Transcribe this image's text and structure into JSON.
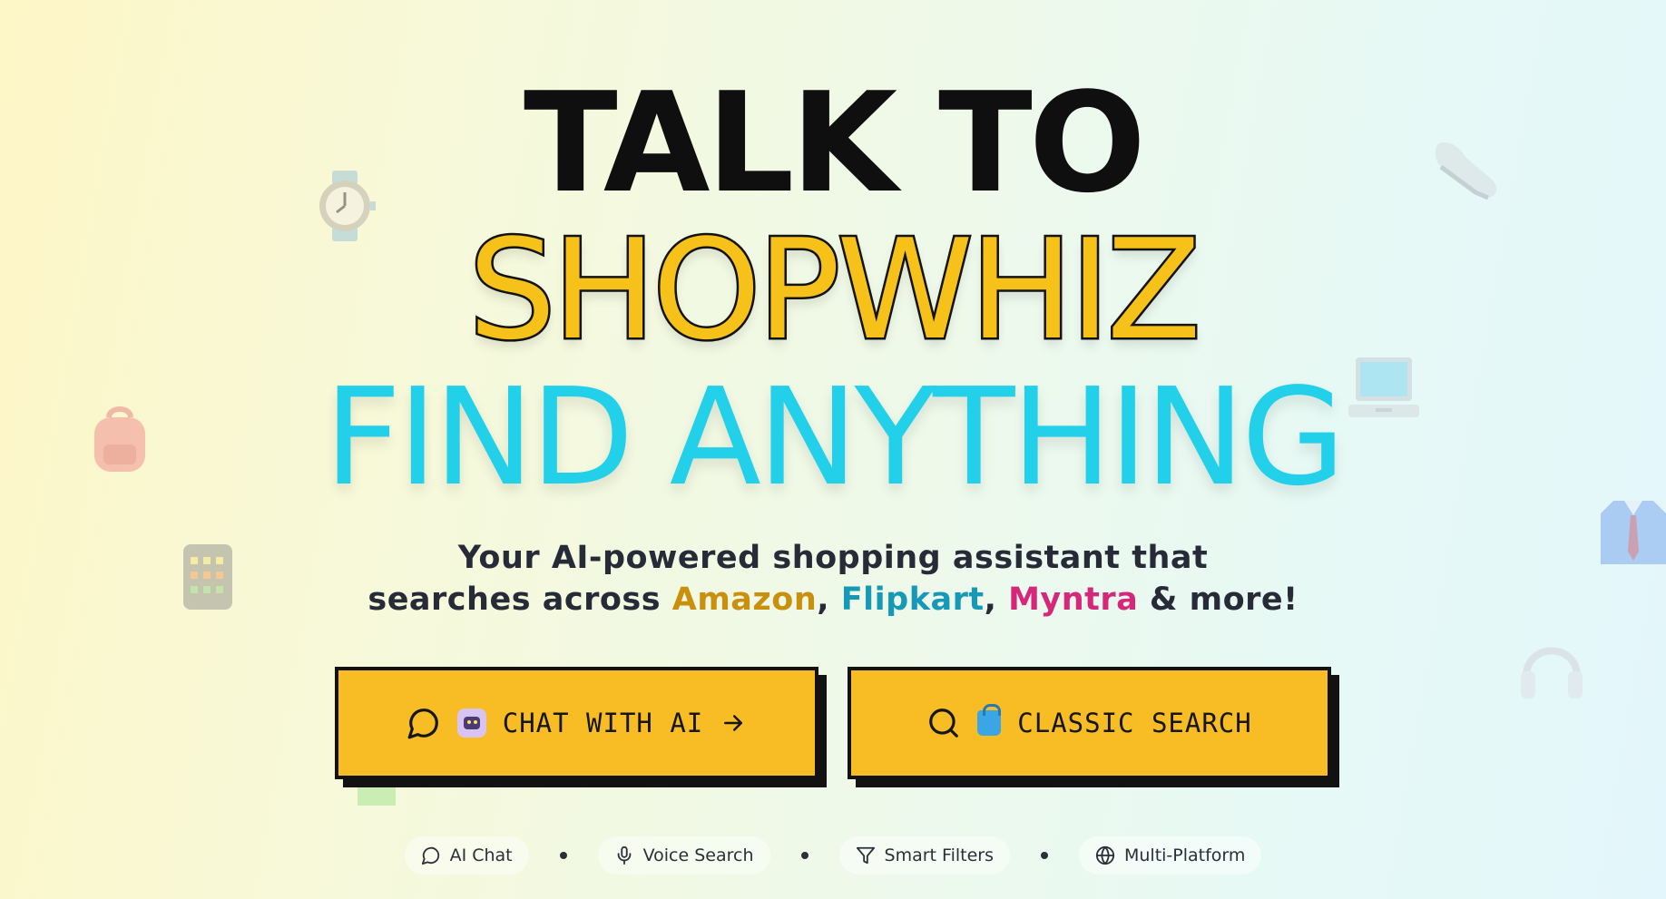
{
  "hero": {
    "line1": "TALK TO",
    "line2": "SHOPWHIZ",
    "line3": "FIND ANYTHING"
  },
  "subtitle": {
    "line1": "Your AI-powered shopping assistant that",
    "prefix": "searches across ",
    "amazon": "Amazon",
    "sep1": ", ",
    "flipkart": "Flipkart",
    "sep2": ", ",
    "myntra": "Myntra",
    "suffix": " & more!"
  },
  "buttons": {
    "chat_label": "CHAT WITH AI",
    "classic_label": "CLASSIC SEARCH"
  },
  "features": [
    {
      "label": "AI Chat",
      "icon": "chat-bubble-icon"
    },
    {
      "label": "Voice Search",
      "icon": "microphone-icon"
    },
    {
      "label": "Smart Filters",
      "icon": "filter-icon"
    },
    {
      "label": "Multi-Platform",
      "icon": "globe-icon"
    }
  ],
  "colors": {
    "accent_yellow": "#f8bd25",
    "headline_cyan": "#22d0ea",
    "headline_yellow": "#f6c21a",
    "amazon": "#c9900e",
    "flipkart": "#1699b6",
    "myntra": "#d6287a"
  },
  "decorations": [
    "watch-icon",
    "sneaker-icon",
    "backpack-icon",
    "laptop-icon",
    "calculator-icon",
    "shirt-icon",
    "headphones-icon"
  ]
}
